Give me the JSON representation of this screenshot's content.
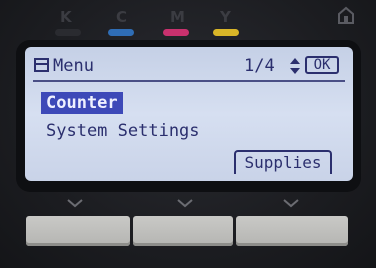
{
  "toner": {
    "labels": [
      "K",
      "C",
      "M",
      "Y"
    ],
    "colors": {
      "K": "#2a2b30",
      "C": "#2f6db5",
      "M": "#c9316e",
      "Y": "#d9b628"
    }
  },
  "screen": {
    "title": "Menu",
    "page_indicator": "1/4",
    "ok_label": "OK",
    "items": [
      {
        "label": "Counter",
        "selected": true
      },
      {
        "label": "System Settings",
        "selected": false
      }
    ],
    "soft_button_label": "Supplies"
  },
  "icons": [
    "menu-icon",
    "up-down-arrow-icon",
    "home-icon",
    "chevron-down-icon"
  ]
}
